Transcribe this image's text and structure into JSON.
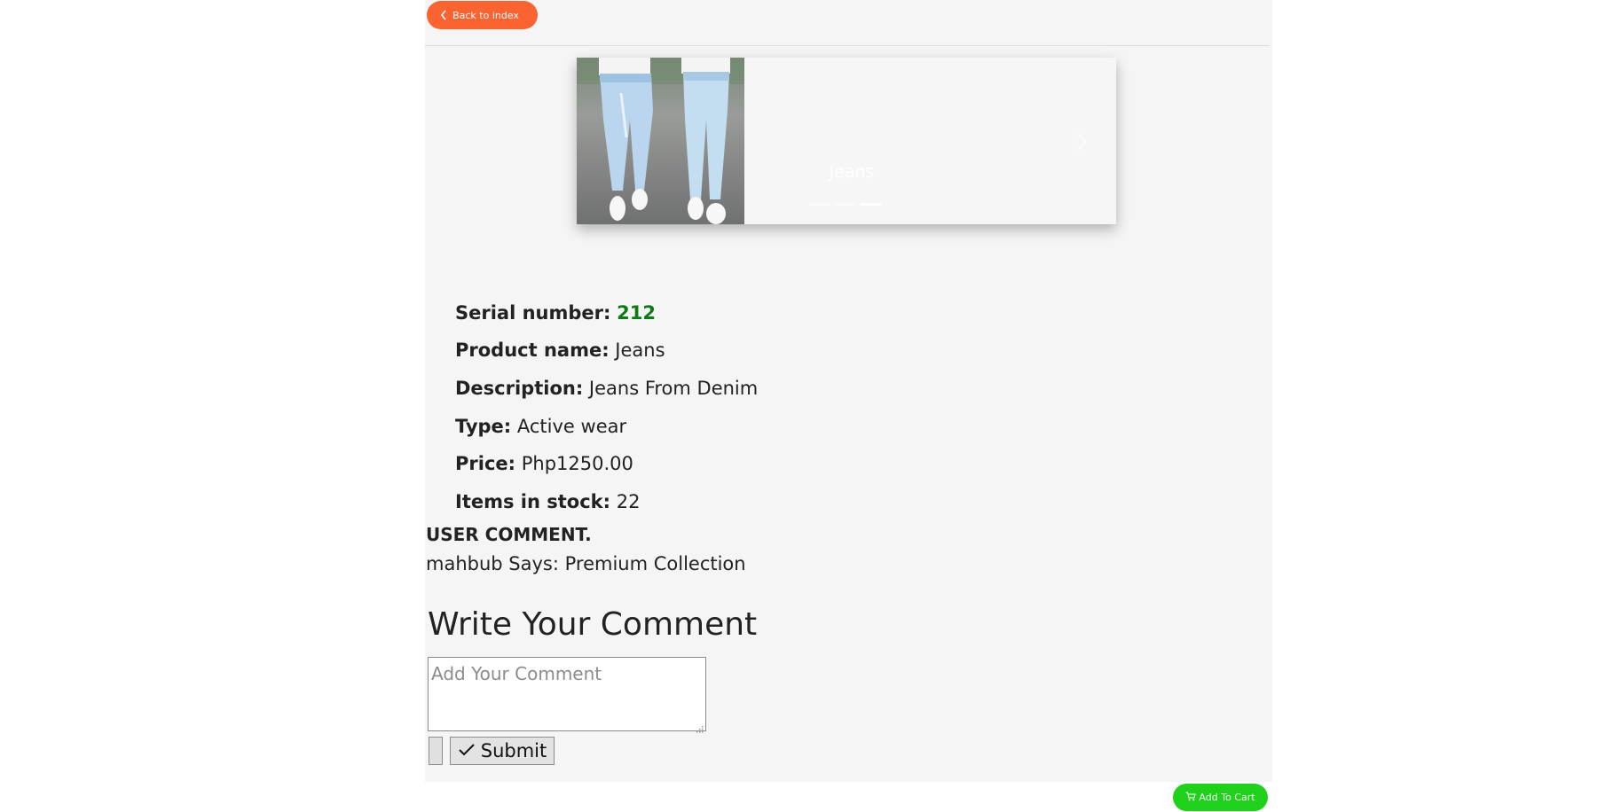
{
  "nav": {
    "back_label": "Back to index",
    "back_icon": "chevron-left-icon"
  },
  "carousel": {
    "caption": "Jeans",
    "slide_count": 3,
    "active_index": 2,
    "image_description": "product-photo-jeans"
  },
  "product": {
    "serial_label": "Serial number:",
    "serial_value": "212",
    "name_label": "Product name:",
    "name_value": "Jeans",
    "description_label": "Description:",
    "description_value": "Jeans From Denim",
    "type_label": "Type:",
    "type_value": "Active wear",
    "price_label": "Price:",
    "price_value": "Php1250.00",
    "stock_label": "Items in stock:",
    "stock_value": "22"
  },
  "comments": {
    "heading": "USER COMMENT.",
    "items": [
      {
        "text": "mahbub Says: Premium Collection"
      }
    ]
  },
  "comment_form": {
    "title": "Write Your Comment",
    "placeholder": "Add Your Comment",
    "value": "",
    "submit_label": "Submit"
  },
  "cart": {
    "add_label": "Add To Cart",
    "icon": "cart-icon"
  },
  "colors": {
    "accent_orange": "#fb6331",
    "cart_green": "#1fd11b",
    "serial_green": "#0d7a13",
    "page_bg": "#f4f5f4"
  }
}
